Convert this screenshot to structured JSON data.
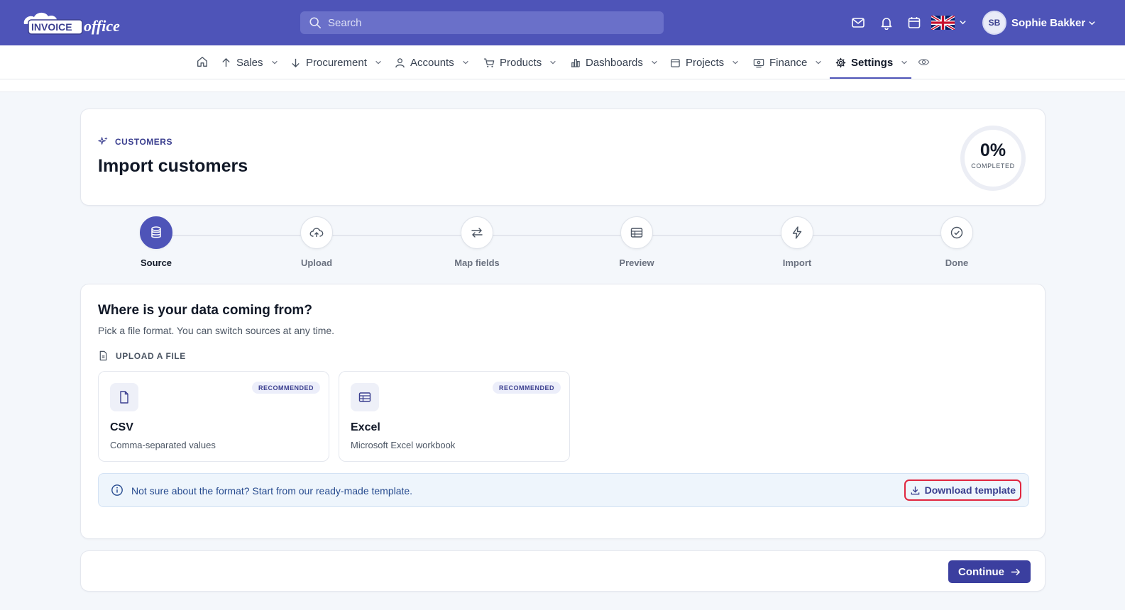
{
  "brand": {
    "logo_text_1": "INVOICE",
    "logo_text_2": "office"
  },
  "header": {
    "search_placeholder": "Search",
    "language_flag": "uk-flag",
    "user": {
      "initials": "SB",
      "name": "Sophie Bakker"
    }
  },
  "nav": {
    "items": [
      {
        "label": "Sales",
        "icon": "arrow-up-icon"
      },
      {
        "label": "Procurement",
        "icon": "arrow-down-icon"
      },
      {
        "label": "Accounts",
        "icon": "user-icon"
      },
      {
        "label": "Products",
        "icon": "cart-icon"
      },
      {
        "label": "Dashboards",
        "icon": "bar-chart-icon"
      },
      {
        "label": "Projects",
        "icon": "calendar-icon"
      },
      {
        "label": "Finance",
        "icon": "finance-icon"
      },
      {
        "label": "Settings",
        "icon": "gear-icon",
        "active": true
      }
    ]
  },
  "page": {
    "eyebrow": "CUSTOMERS",
    "title": "Import customers",
    "progress": {
      "value_text": "0%",
      "label": "COMPLETED",
      "fraction": 0
    }
  },
  "steps": [
    {
      "label": "Source",
      "active": true
    },
    {
      "label": "Upload"
    },
    {
      "label": "Map fields"
    },
    {
      "label": "Preview"
    },
    {
      "label": "Import"
    },
    {
      "label": "Done"
    }
  ],
  "source": {
    "question": "Where is your data coming from?",
    "subtitle": "Pick a file format. You can switch sources at any time.",
    "section_label": "UPLOAD A FILE",
    "options": [
      {
        "title": "CSV",
        "description": "Comma-separated values",
        "badge": "RECOMMENDED"
      },
      {
        "title": "Excel",
        "description": "Microsoft Excel workbook",
        "badge": "RECOMMENDED"
      }
    ],
    "info_text": "Not sure about the format? Start from our ready-made template.",
    "download_label": "Download template"
  },
  "footer": {
    "continue_label": "Continue"
  },
  "colors": {
    "brand": "#4e54b8",
    "primary_button": "#3b3f9f",
    "highlight": "#e0263f"
  }
}
